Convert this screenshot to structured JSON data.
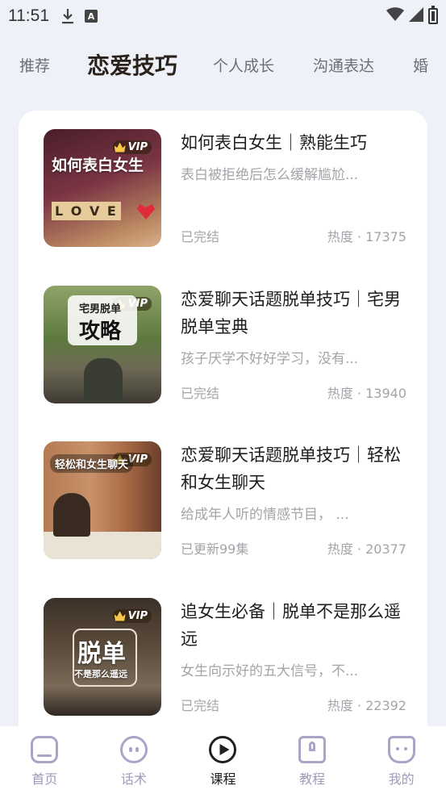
{
  "status_bar": {
    "time": "11:51"
  },
  "tabs": [
    {
      "label": "推荐"
    },
    {
      "label": "恋爱技巧"
    },
    {
      "label": "个人成长"
    },
    {
      "label": "沟通表达"
    },
    {
      "label": "婚"
    }
  ],
  "courses": [
    {
      "title": "如何表白女生｜熟能生巧",
      "desc": "表白被拒绝后怎么缓解尴尬...",
      "status": "已完结",
      "heat": "热度 · 17375",
      "badge": "VIP",
      "thumb_text": "如何表白女生",
      "thumb_sub": "L O V E"
    },
    {
      "title": "恋爱聊天话题脱单技巧｜宅男脱单宝典",
      "desc": "孩子厌学不好好学习，没有...",
      "status": "已完结",
      "heat": "热度 · 13940",
      "badge": "VIP",
      "thumb_text": "宅男脱单",
      "thumb_sub": "攻略"
    },
    {
      "title": "恋爱聊天话题脱单技巧｜轻松和女生聊天",
      "desc": "给成年人听的情感节目， ...",
      "status": "已更新99集",
      "heat": "热度 · 20377",
      "badge": "VIP",
      "thumb_text": "轻松和女生聊天",
      "thumb_sub": ""
    },
    {
      "title": "追女生必备｜脱单不是那么遥远",
      "desc": "女生向示好的五大信号，不...",
      "status": "已完结",
      "heat": "热度 · 22392",
      "badge": "VIP",
      "thumb_text": "脱单",
      "thumb_sub": "不是那么遥远"
    }
  ],
  "bottom_nav": [
    {
      "label": "首页",
      "icon": "home-icon"
    },
    {
      "label": "话术",
      "icon": "chat-face-icon"
    },
    {
      "label": "课程",
      "icon": "play-icon"
    },
    {
      "label": "教程",
      "icon": "book-icon"
    },
    {
      "label": "我的",
      "icon": "cat-face-icon"
    }
  ]
}
